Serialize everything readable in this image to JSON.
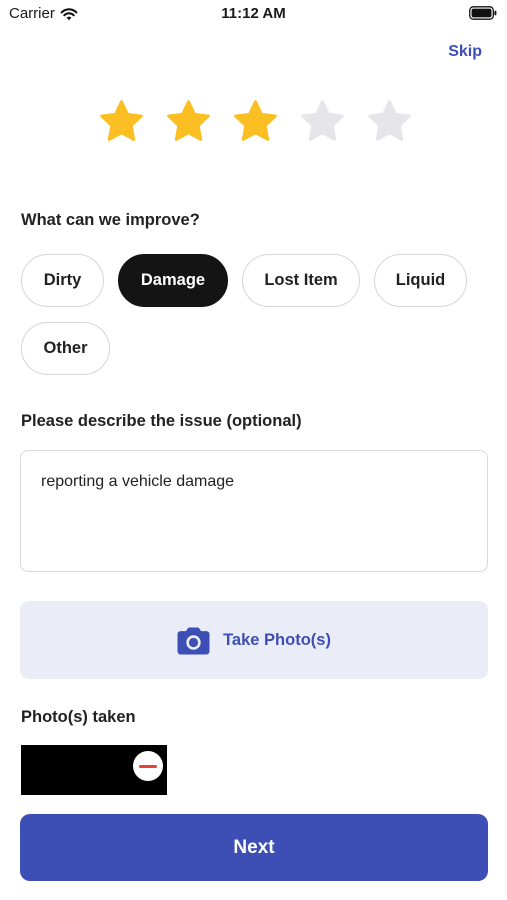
{
  "status_bar": {
    "carrier": "Carrier",
    "time": "11:12 AM",
    "icons": [
      "wifi-icon",
      "battery-icon"
    ]
  },
  "header": {
    "skip_label": "Skip"
  },
  "rating": {
    "value": 3,
    "max": 5,
    "filled_color": "#FBBF24",
    "empty_color": "#E6E6EA"
  },
  "improve": {
    "label": "What can we improve?",
    "options": [
      {
        "label": "Dirty",
        "selected": false
      },
      {
        "label": "Damage",
        "selected": true
      },
      {
        "label": "Lost Item",
        "selected": false
      },
      {
        "label": "Liquid",
        "selected": false
      },
      {
        "label": "Other",
        "selected": false
      }
    ]
  },
  "description": {
    "label": "Please describe the issue (optional)",
    "value": "reporting a vehicle damage"
  },
  "photo": {
    "button_label": "Take Photo(s)",
    "icon": "camera-icon",
    "taken_label": "Photo(s) taken",
    "thumbnail_count": 1,
    "remove_icon": "remove-icon"
  },
  "footer": {
    "next_label": "Next"
  },
  "colors": {
    "accent": "#3D4FB5",
    "accent_light": "#EAECF8",
    "selected_chip": "#141414",
    "remove_red": "#E8412F"
  }
}
